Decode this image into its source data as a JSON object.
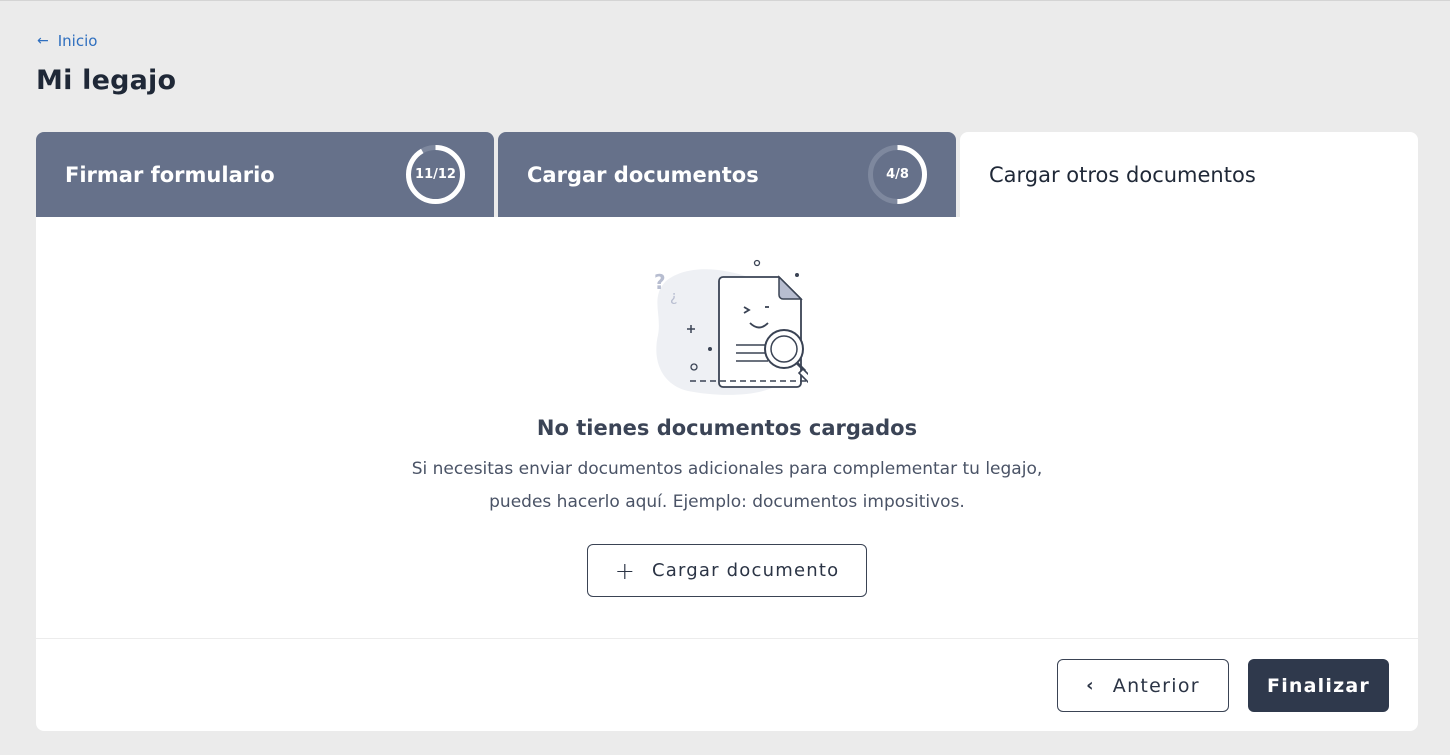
{
  "breadcrumb": {
    "back_label": "Inicio",
    "back_icon": "arrow-left-icon"
  },
  "page": {
    "title": "Mi legajo"
  },
  "tabs": [
    {
      "label": "Firmar formulario",
      "progress_text": "11/12",
      "progress": 0.9167,
      "state": "inactive"
    },
    {
      "label": "Cargar documentos",
      "progress_text": "4/8",
      "progress": 0.5,
      "state": "inactive"
    },
    {
      "label": "Cargar otros documentos",
      "state": "active"
    }
  ],
  "empty_state": {
    "icon": "document-search-illustration",
    "title": "No tienes documentos cargados",
    "description_line1": "Si necesitas enviar documentos adicionales para complementar tu legajo,",
    "description_line2": "puedes hacerlo aquí. Ejemplo: documentos impositivos.",
    "upload_label": "Cargar documento",
    "upload_icon": "plus-icon"
  },
  "footer": {
    "prev_label": "Anterior",
    "prev_icon": "chevron-left-icon",
    "finish_label": "Finalizar"
  },
  "colors": {
    "background": "#ebebeb",
    "tab_inactive": "#66718a",
    "link": "#2f6fbf",
    "primary_button": "#2f394c"
  }
}
